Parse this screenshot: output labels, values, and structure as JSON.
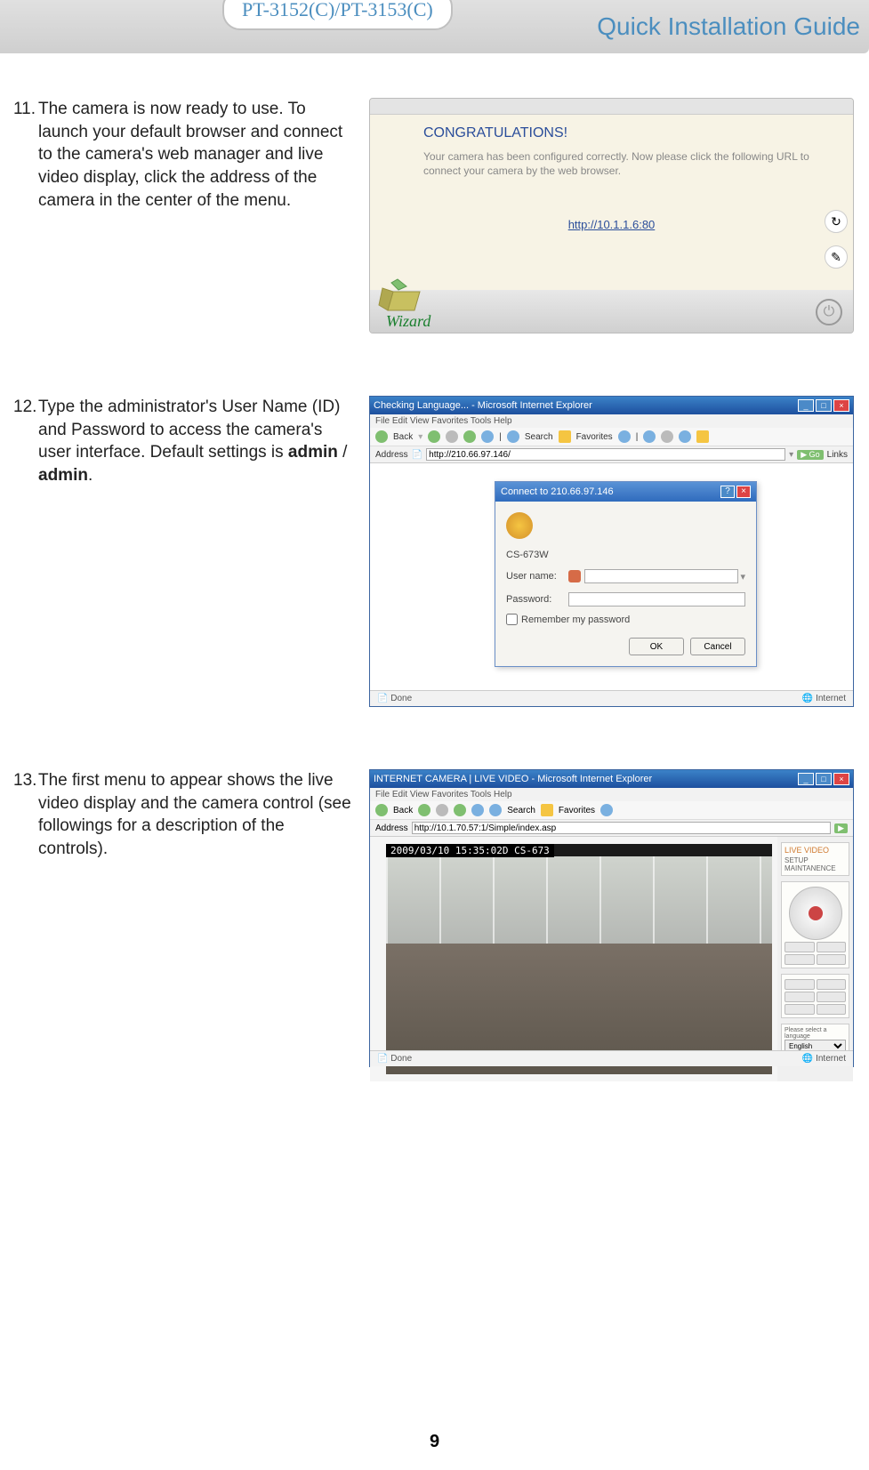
{
  "header": {
    "model": "PT-3152(C)/PT-3153(C)",
    "title": "Quick Installation Guide"
  },
  "steps": {
    "s11": {
      "num": "11.",
      "text": "The camera is now ready to use. To launch your default browser and connect to the camera's web manager and live video display, click the address of the camera in the center of the menu."
    },
    "s12": {
      "num": "12.",
      "textA": "Type the administrator's User Name (ID) and Password to access the camera's user interface. Default settings is ",
      "bold1": "admin",
      "slash": " / ",
      "bold2": "admin",
      "dot": "."
    },
    "s13": {
      "num": "13.",
      "text": "The first menu to appear shows the live video display and the camera control (see followings for a description of the controls)."
    }
  },
  "wizard": {
    "congrats": "CONGRATULATIONS!",
    "msg": "Your camera has been configured correctly. Now please click the following URL to connect your camera by the web browser.",
    "link": "http://10.1.1.6:80",
    "label": "Wizard"
  },
  "ie": {
    "title": "Checking Language... - Microsoft Internet Explorer",
    "menu": "File    Edit    View    Favorites    Tools    Help",
    "back": "Back",
    "search": "Search",
    "fav": "Favorites",
    "addrLabel": "Address",
    "addr": "http://210.66.97.146/",
    "go": "Go",
    "links": "Links",
    "dlg": {
      "title": "Connect to 210.66.97.146",
      "server": "CS-673W",
      "userLabel": "User name:",
      "passLabel": "Password:",
      "remember": "Remember my password",
      "ok": "OK",
      "cancel": "Cancel"
    },
    "status_left": "Done",
    "status_right": "Internet"
  },
  "live": {
    "title": "INTERNET CAMERA | LIVE VIDEO - Microsoft Internet Explorer",
    "menu": "File  Edit  View  Favorites  Tools  Help",
    "addr": "http://10.1.70.57:1/Simple/index.asp",
    "timestamp": "2009/03/10 15:35:02D CS-673",
    "side_title1": "LIVE VIDEO",
    "side_title2": "SETUP",
    "side_title3": "MAINTANENCE",
    "langLabel": "Please select a language",
    "lang": "English",
    "status_left": "Done",
    "status_right": "Internet"
  },
  "pageNumber": "9"
}
